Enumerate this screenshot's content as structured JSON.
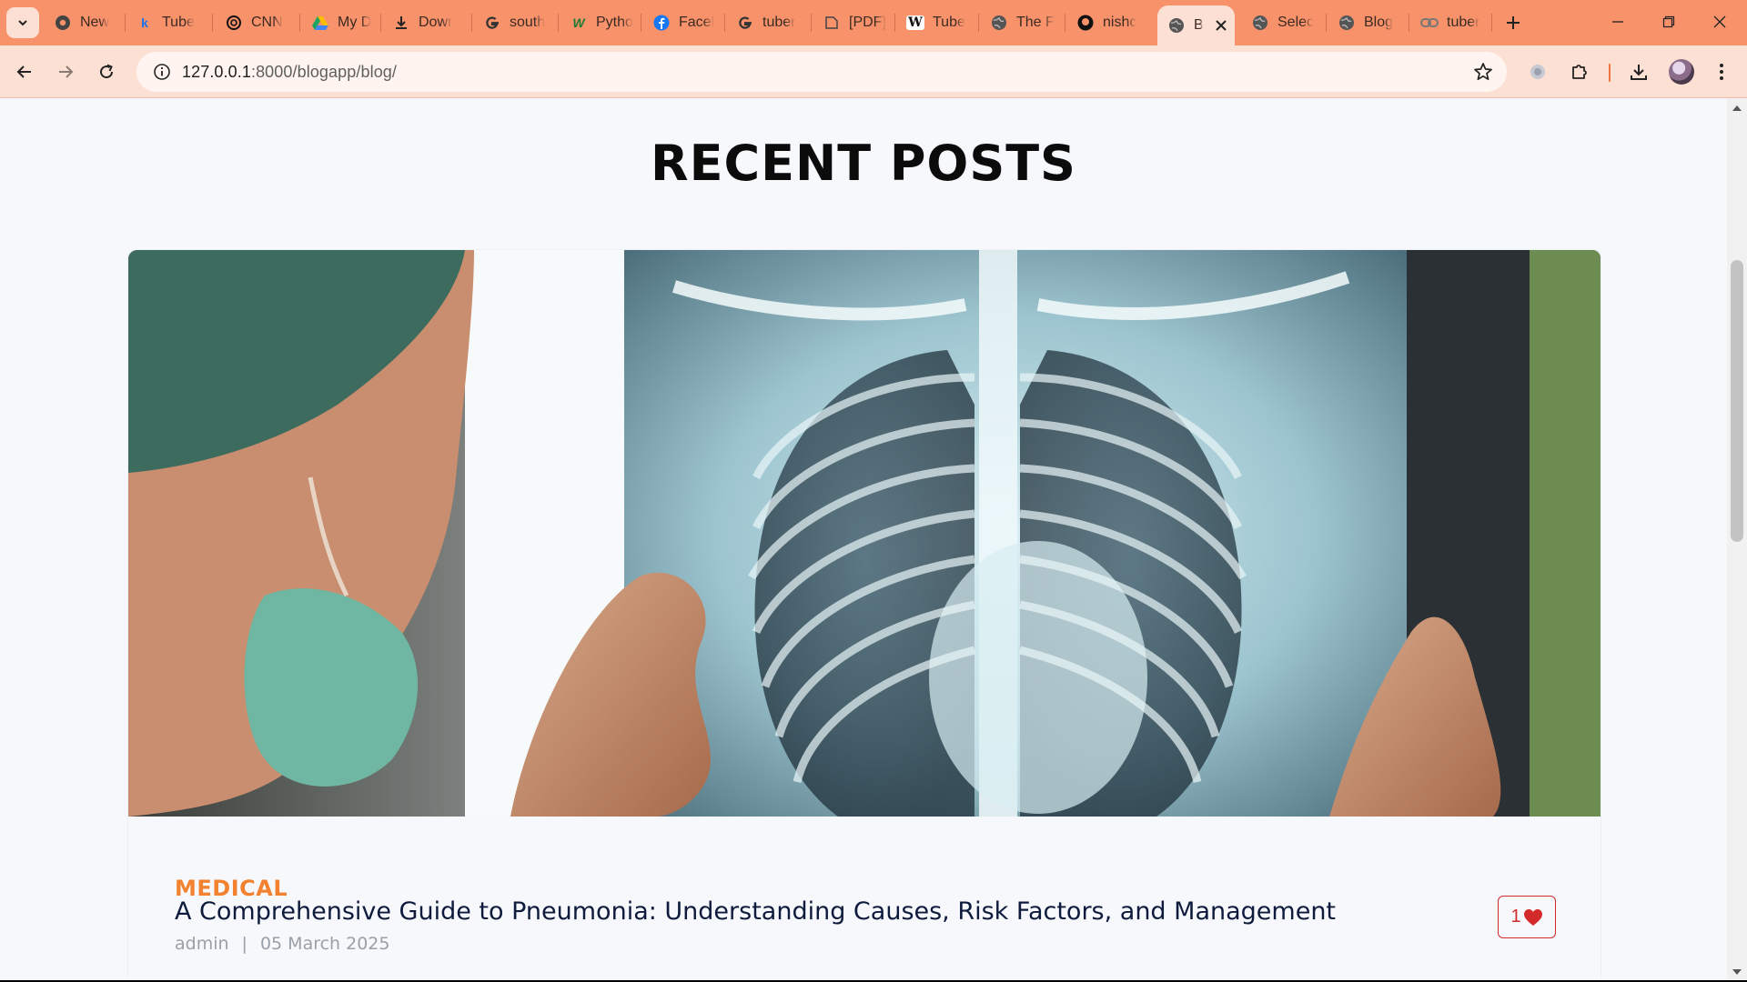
{
  "browser": {
    "tabs": [
      {
        "title": "New",
        "icon": "chrome-icon"
      },
      {
        "title": "Tube",
        "icon": "k-icon"
      },
      {
        "title": "CNN",
        "icon": "openai-icon"
      },
      {
        "title": "My D",
        "icon": "drive-icon"
      },
      {
        "title": "Dowr",
        "icon": "download-icon"
      },
      {
        "title": "south",
        "icon": "google-icon"
      },
      {
        "title": "Pytho",
        "icon": "w-icon"
      },
      {
        "title": "Facel",
        "icon": "facebook-icon"
      },
      {
        "title": "tuber",
        "icon": "google-icon"
      },
      {
        "title": "[PDF]",
        "icon": "pdf-icon"
      },
      {
        "title": "Tube",
        "icon": "wikipedia-icon"
      },
      {
        "title": "The F",
        "icon": "globe-icon"
      },
      {
        "title": "nishc",
        "icon": "github-icon"
      },
      {
        "title": "B",
        "icon": "globe-icon",
        "active": true
      },
      {
        "title": "Selec",
        "icon": "globe-icon"
      },
      {
        "title": "Blog",
        "icon": "globe-icon"
      },
      {
        "title": "tuber",
        "icon": "link-icon"
      }
    ],
    "url_host": "127.0.0.1",
    "url_rest": ":8000/blogapp/blog/"
  },
  "page": {
    "heading": "RECENT POSTS",
    "post": {
      "category": "MEDICAL",
      "title": "A Comprehensive Guide to Pneumonia: Understanding Causes, Risk Factors, and Management",
      "author": "admin",
      "separator": "|",
      "date": "05 March 2025",
      "likes": "1"
    }
  },
  "colors": {
    "tab_strip": "#f7926b",
    "toolbar": "#fce0d4",
    "category": "#f2822f",
    "like": "#d32a2a",
    "title": "#0e1b3d"
  }
}
